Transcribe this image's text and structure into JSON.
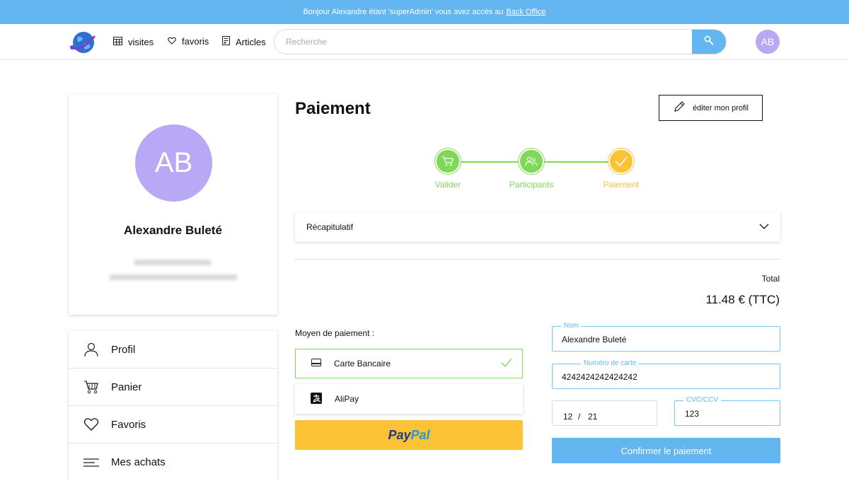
{
  "banner": {
    "text": "Bonjour Alexandre étant 'superAdmin' vous avez accès au",
    "link": "Back Office"
  },
  "nav": {
    "links": [
      {
        "label": "visites",
        "icon": "calendar-icon"
      },
      {
        "label": "favoris",
        "icon": "heart-icon"
      },
      {
        "label": "Articles",
        "icon": "document-icon"
      }
    ],
    "search_placeholder": "Recherche",
    "avatar_initials": "AB"
  },
  "profile": {
    "initials": "AB",
    "name": "Alexandre Buleté"
  },
  "menu": {
    "items": [
      {
        "label": "Profil",
        "icon": "user-icon"
      },
      {
        "label": "Panier",
        "icon": "cart-icon"
      },
      {
        "label": "Favoris",
        "icon": "heart-icon"
      },
      {
        "label": "Mes achats",
        "icon": "list-icon"
      }
    ]
  },
  "payment": {
    "title": "Paiement",
    "edit_profile": "éditer mon profil",
    "steps": [
      {
        "label": "Valider",
        "color": "#7ed957"
      },
      {
        "label": "Participants",
        "color": "#7ed957"
      },
      {
        "label": "Paiement",
        "color": "#fbc235"
      }
    ],
    "recap_label": "Récapitulatif",
    "total_label": "Total",
    "total_value": "11.48 € (TTC)",
    "methods_label": "Moyen de paiement :",
    "methods": [
      {
        "label": "Carte Bancaire",
        "icon": "credit-card-icon",
        "selected": true
      },
      {
        "label": "AliPay",
        "icon": "alipay-icon",
        "selected": false
      }
    ],
    "paypal": {
      "part1": "Pay",
      "part2": "Pal"
    },
    "form": {
      "name_label": "Nom",
      "name_value": "Alexandre Buleté",
      "card_label": "Numéro de carte",
      "card_value": "4242424242424242",
      "exp_month": "12",
      "exp_sep": "/",
      "exp_year": "21",
      "cvc_label": "CVC/CCV",
      "cvc_value": "123"
    },
    "confirm_label": "Confirmer le paiement"
  },
  "colors": {
    "accent": "#63b6f0",
    "success": "#7ed957",
    "warning": "#fbc235",
    "avatar": "#b9a8f5"
  }
}
